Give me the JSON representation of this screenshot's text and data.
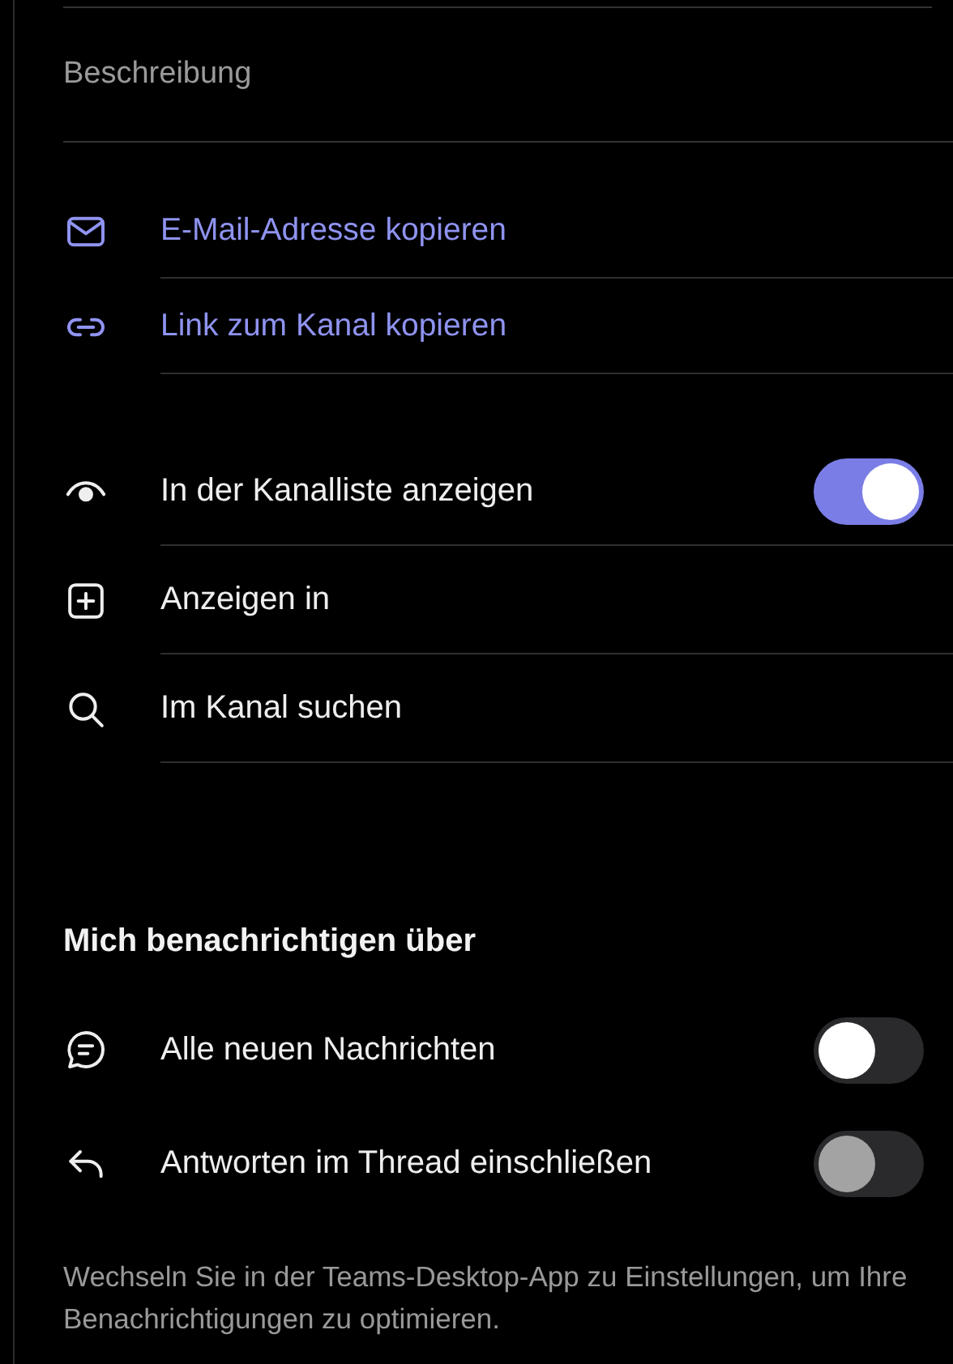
{
  "description": {
    "label": "Beschreibung"
  },
  "actions": [
    {
      "label": "E-Mail-Adresse kopieren"
    },
    {
      "label": "Link zum Kanal kopieren"
    }
  ],
  "settings": [
    {
      "kind": "toggle",
      "label": "In der Kanalliste anzeigen",
      "on": true,
      "disabled": false
    },
    {
      "kind": "nav",
      "label": "Anzeigen in"
    },
    {
      "kind": "nav",
      "label": "Im Kanal suchen"
    }
  ],
  "notifications": {
    "heading": "Mich benachrichtigen über",
    "items": [
      {
        "label": "Alle neuen Nachrichten",
        "on": false,
        "disabled": false
      },
      {
        "label": "Antworten im Thread einschließen",
        "on": false,
        "disabled": true
      }
    ]
  },
  "footer": "Wechseln Sie in der Teams-Desktop-App zu Einstellungen, um Ihre Benachrichtigungen zu optimieren."
}
